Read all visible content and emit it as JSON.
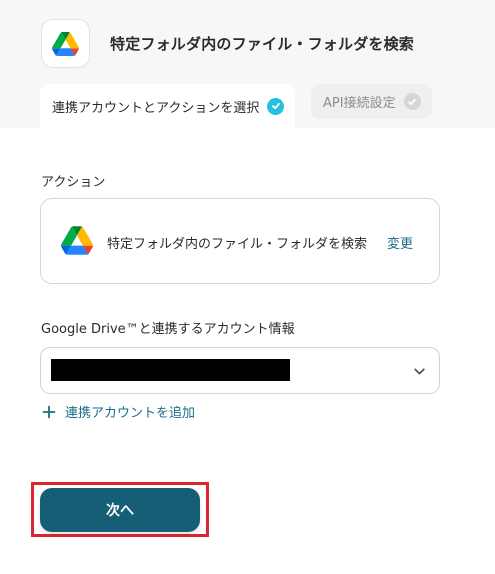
{
  "header": {
    "app_icon": "google-drive-icon",
    "title": "特定フォルダ内のファイル・フォルダを検索"
  },
  "tabs": [
    {
      "label": "連携アカウントとアクションを選択",
      "state": "active",
      "status_icon": "check-circle-icon"
    },
    {
      "label": "API接続設定",
      "state": "inactive",
      "status_icon": "check-circle-icon"
    }
  ],
  "action": {
    "section_label": "アクション",
    "name": "特定フォルダ内のファイル・フォルダを検索",
    "change_label": "変更",
    "icon": "google-drive-icon"
  },
  "account": {
    "section_label": "Google Drive™と連携するアカウント情報",
    "value": "",
    "value_redacted": true,
    "dropdown_icon": "chevron-down-icon",
    "add_label": "連携アカウントを追加",
    "add_icon": "plus-icon"
  },
  "footer": {
    "next_label": "次へ"
  },
  "colors": {
    "accent": "#155e76",
    "link": "#1a6e88",
    "check_active": "#27bfe0",
    "check_inactive": "#d6d6d6",
    "highlight": "#e0232e"
  }
}
